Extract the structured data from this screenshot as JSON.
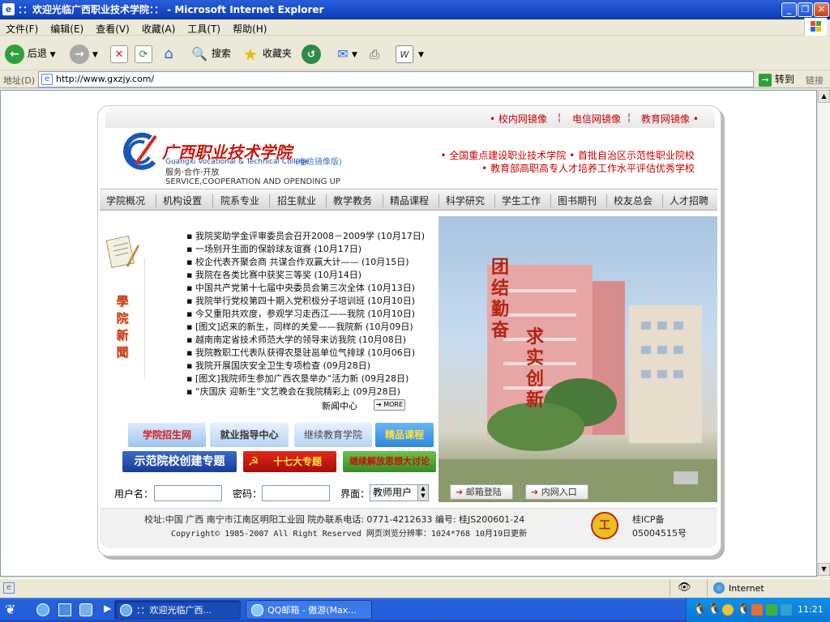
{
  "window": {
    "title": "：：欢迎光临广西职业技术学院：：  - Microsoft Internet Explorer"
  },
  "menu": [
    "文件(F)",
    "编辑(E)",
    "查看(V)",
    "收藏(A)",
    "工具(T)",
    "帮助(H)"
  ],
  "toolbar": {
    "back": "后退",
    "search": "搜索",
    "favorites": "收藏夹"
  },
  "address": {
    "label": "地址(D)",
    "url": "http://www.gxzjy.com/",
    "go": "转到",
    "links": "链接"
  },
  "site": {
    "mirrors": [
      "• 校内网镜像",
      "电信网镜像",
      "教育网镜像 •"
    ],
    "logo": {
      "cn": "广西职业技术学院",
      "en": "Guangxi Vocational & Technical College",
      "tag": "(电信镜像版)"
    },
    "slogan": {
      "cn": "服务·合作·开放",
      "en": "SERVICE,COOPERATION AND OPENDING UP"
    },
    "badges": [
      "• 全国重点建设职业技术学院   • 首批自治区示范性职业院校",
      "• 教育部高职高专人才培养工作水平评估优秀学校"
    ],
    "nav": [
      "学院概况",
      "机构设置",
      "院系专业",
      "招生就业",
      "教学教务",
      "精品课程",
      "科学研究",
      "学生工作",
      "图书期刊",
      "校友总会",
      "人才招聘"
    ],
    "news_title": "學院新聞",
    "news": [
      "▪ 我院奖助学金评审委员会召开2008－2009学  (10月17日)",
      "▪ 一场别开生面的保龄球友谊赛  (10月17日)",
      "▪ 校企代表齐聚会商 共谋合作双赢大计——  (10月15日)",
      "▪ 我院在各类比赛中获奖三等奖  (10月14日)",
      "▪ 中国共产党第十七届中央委员会第三次全体  (10月13日)",
      "▪ 我院举行党校第四十期入党积极分子培训班  (10月10日)",
      "▪ 今又重阳共欢度，参观学习走西江——我院  (10月10日)",
      "▪ [图文]迟来的新生，同样的关爱——我院新  (10月09日)",
      "▪ 越南南定省技术师范大学的领导来访我院  (10月08日)",
      "▪ 我院教职工代表队获得农垦驻邕单位气排球  (10月06日)",
      "▪ 我院开展国庆安全卫生专项检查  (09月28日)",
      "▪ [图文]我院师生参加广西农垦举办“活力新  (09月28日)",
      "▪ “庆国庆 迎新生”文艺晚会在我院精彩上  (09月28日)"
    ],
    "news_center": "新闻中心",
    "more": "➔ MORE",
    "motto1": "团结勤奋",
    "motto2": "求实创新",
    "quick1": [
      "学院招生网",
      "就业指导中心",
      "继续教育学院",
      "精品课程"
    ],
    "quick2": [
      "示范院校创建专题",
      "十七大专题",
      "继续解放思想大讨论"
    ],
    "login": {
      "user": "用户名：",
      "pass": "密码：",
      "ui": "界面：",
      "ui_value": "教师用户",
      "mail": "邮箱登陆",
      "intranet": "内网入口"
    },
    "footer": {
      "addr": "校址:中国 广西 南宁市江南区明阳工业园   院办联系电话: 0771-4212633   编号: 桂JS200601-24",
      "copy": "Copyright© 1985-2007 All Right Reserved    网页浏览分辨率：1024*768 10月19日更新",
      "icp1": "桂ICP备",
      "icp2": "05004515号"
    }
  },
  "status": {
    "zone": "Internet"
  },
  "taskbar": {
    "items": [
      "：：欢迎光临广西...",
      "QQ邮箱 - 傲游(Max..."
    ],
    "clock": "11:21"
  }
}
